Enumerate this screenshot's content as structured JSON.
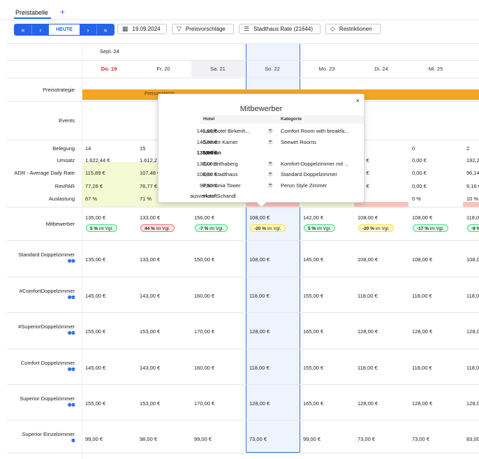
{
  "tabs": {
    "active": "Preistabelle",
    "add": "+"
  },
  "toolbar": {
    "nav_first": "«",
    "nav_prev": "‹",
    "today": "HEUTE",
    "nav_next": "›",
    "nav_last": "»",
    "date": "19.09.2024",
    "suggestions": "Preisvorschläge",
    "rate": "Stadthaus Rate  (21644)",
    "restrictions": "Restriktionen"
  },
  "month": "Sept. 24",
  "days": [
    "Do. 19",
    "Fr. 20",
    "Sa. 21",
    "So. 22",
    "Mo. 23",
    "Di. 24",
    "Mi. 25"
  ],
  "row_labels": {
    "strategy": "Preisstrategie",
    "events": "Events",
    "belegung": "Belegung",
    "umsatz": "Umsatz",
    "adr": "ADR - Average Daily Rate",
    "revpar": "RevPAR",
    "auslastung": "Auslastung",
    "mitbewerber": "Mitbewerber"
  },
  "strategy_text": "Preisstrategie",
  "kpis": {
    "belegung": [
      "14",
      "15",
      "",
      "",
      "",
      "",
      "0",
      "2"
    ],
    "umsatz": [
      "1.622,44 €",
      "1.612,2",
      "",
      "",
      "",
      ",09 €",
      "0,00 €",
      "192,2"
    ],
    "adr": [
      "115,89 €",
      "107,48 €",
      "",
      "",
      "",
      ",09 €",
      "0,00 €",
      "96,14"
    ],
    "revpar": [
      "77,26 €",
      "76,77 €",
      "",
      "",
      "",
      ",82 €",
      "0,00 €",
      "9,16 €"
    ],
    "auslastung": [
      "67 %",
      "71 %",
      "",
      "",
      "",
      "%",
      "0 %",
      "10 %"
    ]
  },
  "competitors": {
    "prices": [
      "135,00 €",
      "133,00 €",
      "156,00 €",
      "108,00 €",
      "142,00 €",
      "108,00 €",
      "108,00 €",
      "118,00"
    ],
    "diffs": [
      {
        "pct": "5 %",
        "txt": "im Vgl.",
        "kind": "g"
      },
      {
        "pct": "44 %",
        "txt": "im Vgl.",
        "kind": "r"
      },
      {
        "pct": "-7 %",
        "txt": "im Vgl.",
        "kind": "g"
      },
      {
        "pct": "-20 %",
        "txt": "im Vgl.",
        "kind": "y"
      },
      {
        "pct": "5 %",
        "txt": "im Vgl.",
        "kind": "g"
      },
      {
        "pct": "-20 %",
        "txt": "im Vgl.",
        "kind": "y"
      },
      {
        "pct": "-17 %",
        "txt": "im Vgl.",
        "kind": "g"
      },
      {
        "pct": "-9 %",
        "txt": "",
        "kind": "g"
      }
    ]
  },
  "rooms": [
    {
      "name": "Standard Doppelzimmer",
      "people": 2,
      "prices": [
        "135,00 €",
        "133,00 €",
        "150,00 €",
        "108,00 €",
        "145,00 €",
        "108,00 €",
        "108,00 €",
        "108,00"
      ]
    },
    {
      "name": "#ComfortDoppelzimmer",
      "people": 2,
      "prices": [
        "145,00 €",
        "143,00 €",
        "160,00 €",
        "118,00 €",
        "155,00 €",
        "118,00 €",
        "118,00 €",
        "118,00"
      ]
    },
    {
      "name": "#SuperiorDoppelzimmer",
      "people": 2,
      "prices": [
        "155,00 €",
        "153,00 €",
        "170,00 €",
        "128,00 €",
        "165,00 €",
        "128,00 €",
        "128,00 €",
        "128,00"
      ]
    },
    {
      "name": "Comfort Doppelzimmer",
      "people": 2,
      "prices": [
        "145,00 €",
        "143,00 €",
        "160,00 €",
        "118,00 €",
        "155,00 €",
        "118,00 €",
        "118,00 €",
        "118,00"
      ]
    },
    {
      "name": "Superior Doppelzimmer",
      "people": 2,
      "prices": [
        "155,00 €",
        "153,00 €",
        "170,00 €",
        "128,00 €",
        "165,00 €",
        "128,00 €",
        "128,00 €",
        "128,00"
      ]
    },
    {
      "name": "Superior Einzelzimmer",
      "people": 1,
      "prices": [
        "99,00 €",
        "98,00 €",
        "99,00 €",
        "73,00 €",
        "99,00 €",
        "73,00 €",
        "73,00 €",
        "83,00"
      ]
    }
  ],
  "popup": {
    "title": "Mitbewerber",
    "close": "×",
    "col_hotel": "Hotel",
    "col_category": "Kategorie",
    "rows": [
      {
        "price": "140,00 €",
        "hotel": "Landhotel Birkenh...",
        "icon": true,
        "category": "Comfort Room with breakfa..."
      },
      {
        "price": "140,00 €",
        "hotel": "Seewirt Karner",
        "icon": true,
        "category": "Seewirt Rooms"
      },
      {
        "price": "135,00 €",
        "hotel": "Median",
        "icon": false,
        "category": "",
        "bold": true
      },
      {
        "price": "130,00 €",
        "hotel": "Gut Leithaberg",
        "icon": true,
        "category": "Komfort-Doppelzimmer mit ..."
      },
      {
        "price": "108,00 €",
        "hotel": "Das Stadthaus",
        "icon": true,
        "category": "Standard Doppelzimmer"
      },
      {
        "price": "90,50 €",
        "hotel": "Pannonia Tower",
        "icon": true,
        "category": "Perun Style Zimmer"
      },
      {
        "price": "ausverkauft",
        "hotel": "Hotel Schandl",
        "icon": false,
        "category": ""
      }
    ]
  },
  "colors": {
    "accent": "#2563eb",
    "strategy": "#f5a524",
    "kpi_green": "#f3f9d2",
    "kpi_red": "#fbc2b8",
    "selected_bg": "#eef3fd"
  }
}
